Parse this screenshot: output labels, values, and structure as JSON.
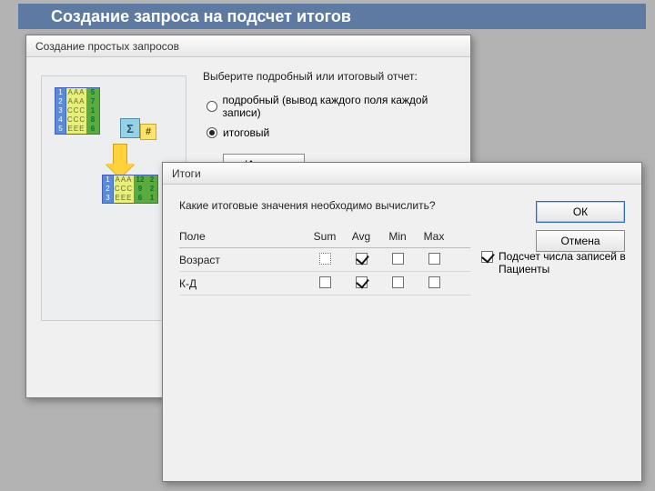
{
  "slide": {
    "title": "Создание запроса на подсчет итогов"
  },
  "wizard": {
    "title": "Создание простых запросов",
    "prompt": "Выберите подробный или итоговый отчет:",
    "radio_detail_full": "подробный (вывод каждого поля каждой записи)",
    "radio_detail_key": "б",
    "radio_summary": "итоговый",
    "radio_summary_key": "и",
    "totals_btn": "Итоги...",
    "totals_btn_key": "т",
    "illus": {
      "sigma": "Σ",
      "hash": "#",
      "src": [
        {
          "n": "1",
          "a": "AAA",
          "v": "5"
        },
        {
          "n": "2",
          "a": "AAA",
          "v": "7"
        },
        {
          "n": "3",
          "a": "CCC",
          "v": "1"
        },
        {
          "n": "4",
          "a": "CCC",
          "v": "8"
        },
        {
          "n": "5",
          "a": "EEE",
          "v": "6"
        }
      ],
      "dst": [
        {
          "n": "1",
          "a": "AAA",
          "v": "12",
          "c": "2"
        },
        {
          "n": "2",
          "a": "CCC",
          "v": "9",
          "c": "2"
        },
        {
          "n": "3",
          "a": "EEE",
          "v": "6",
          "c": "1"
        }
      ]
    }
  },
  "totals": {
    "title": "Итоги",
    "question": "Какие итоговые значения необходимо вычислить?",
    "col_field": "Поле",
    "cols": [
      "Sum",
      "Avg",
      "Min",
      "Max"
    ],
    "rows": [
      {
        "field": "Возраст",
        "sum": false,
        "sum_dotted": true,
        "avg": true,
        "min": false,
        "max": false
      },
      {
        "field": "К-Д",
        "sum": false,
        "sum_dotted": false,
        "avg": true,
        "min": false,
        "max": false
      }
    ],
    "ok": "ОК",
    "cancel": "Отмена",
    "count_label": "Подсчет числа записей в Пациенты",
    "count_checked": true
  }
}
